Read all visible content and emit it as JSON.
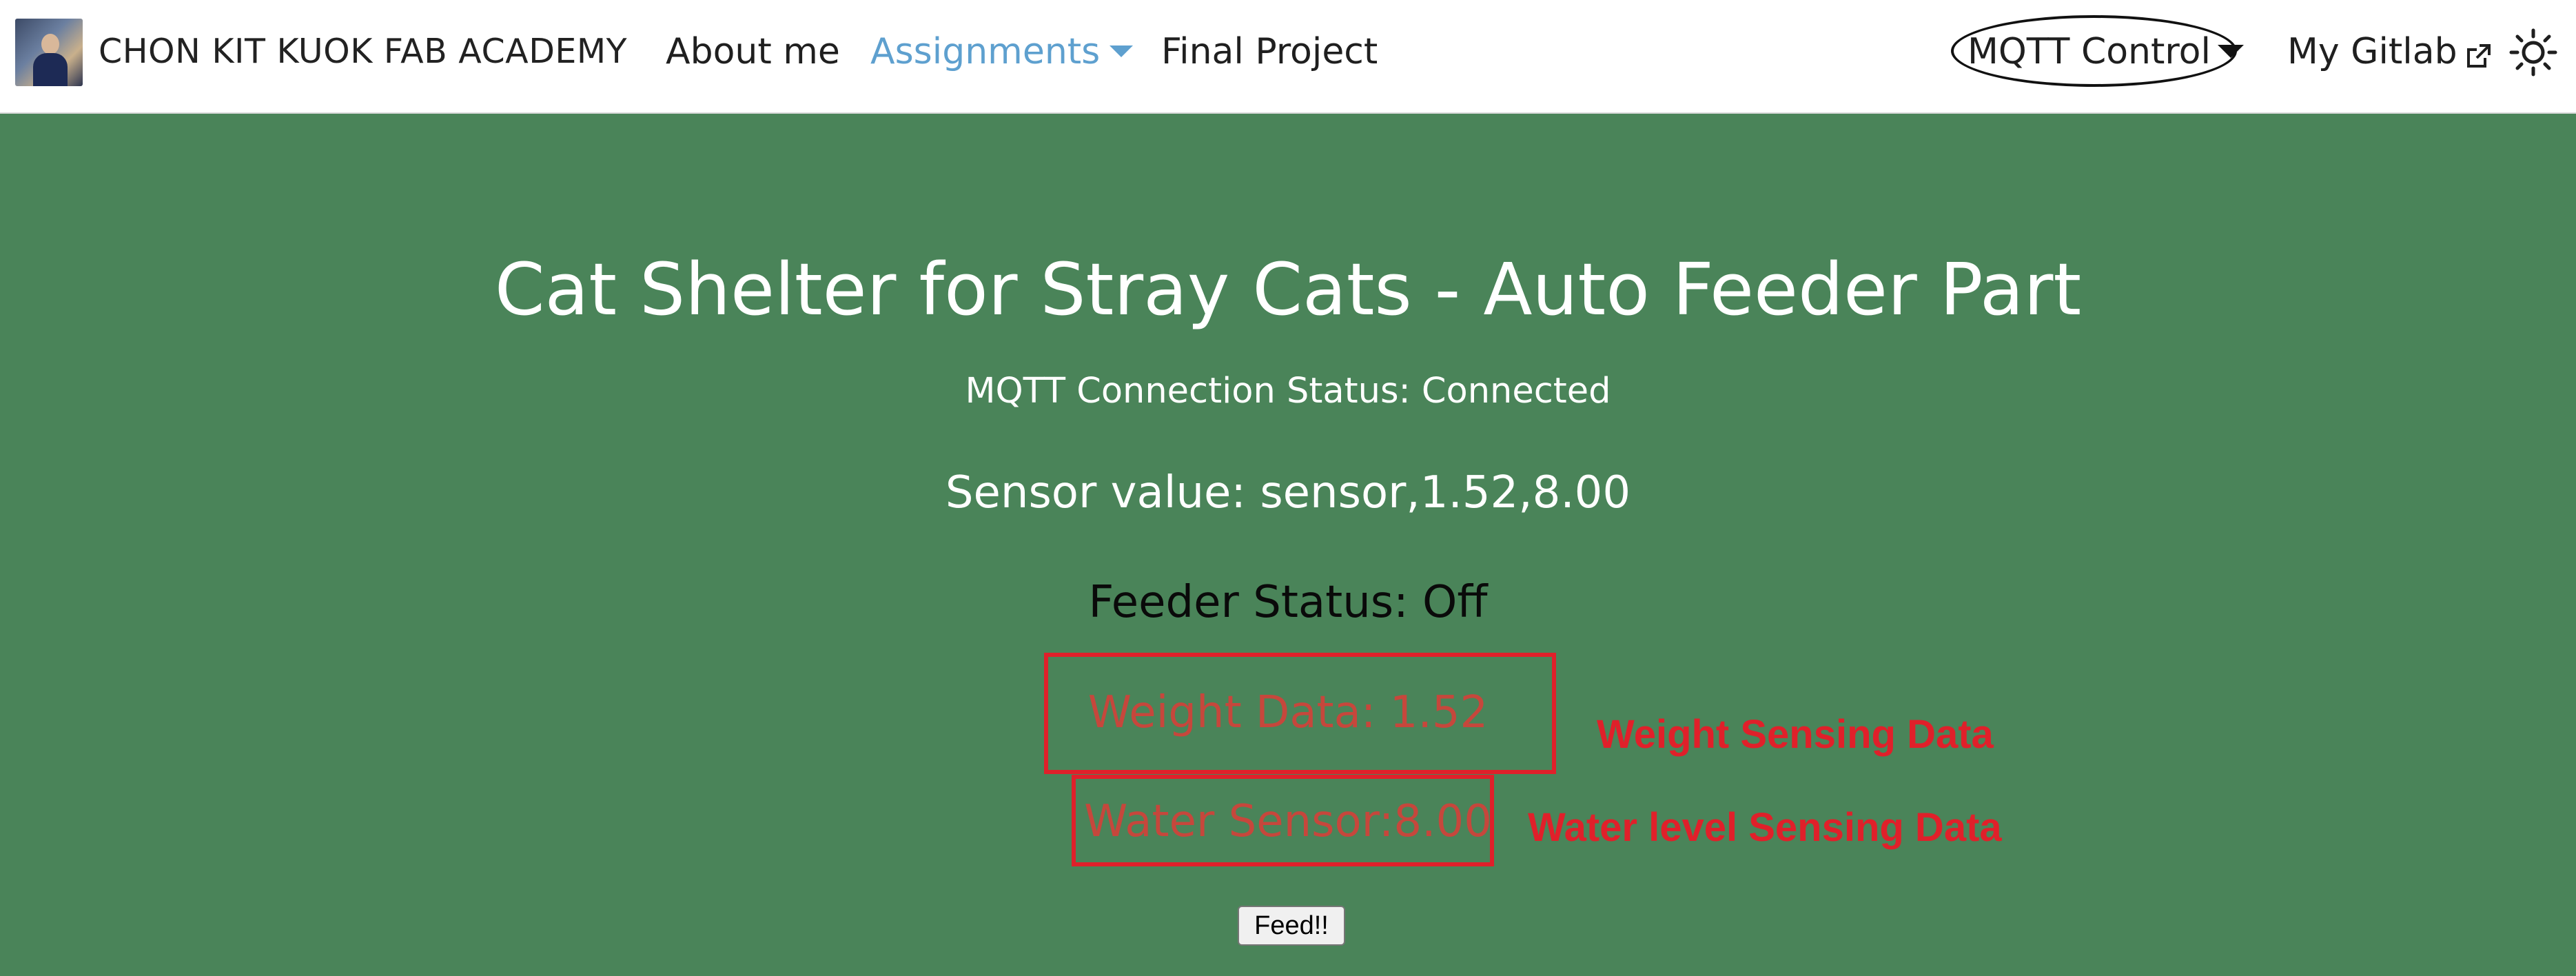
{
  "navbar": {
    "brand_title": "CHON KIT KUOK FAB ACADEMY",
    "links": {
      "about": "About me",
      "assignments": "Assignments",
      "final_project": "Final Project",
      "mqtt_control": "MQTT Control",
      "gitlab": "My Gitlab"
    },
    "active_link_color": "#5ea0cf",
    "icons": {
      "dropdown": "chevron-down-icon",
      "external": "external-link-icon",
      "theme": "sun-icon"
    }
  },
  "main": {
    "title": "Cat Shelter for Stray Cats - Auto Feeder Part",
    "connection_status": "MQTT Connection Status: Connected",
    "sensor_value": "Sensor value: sensor,1.52,8.00",
    "feeder_status": "Feeder Status: Off",
    "weight_data": "Weight Data: 1.52",
    "water_data": "Water Sensor:8.00",
    "feed_button": "Feed!!",
    "background_color": "#4a8459"
  },
  "annotations": {
    "weight": "Weight Sensing Data",
    "water": "Water level Sensing Data",
    "color": "#e0202a"
  }
}
